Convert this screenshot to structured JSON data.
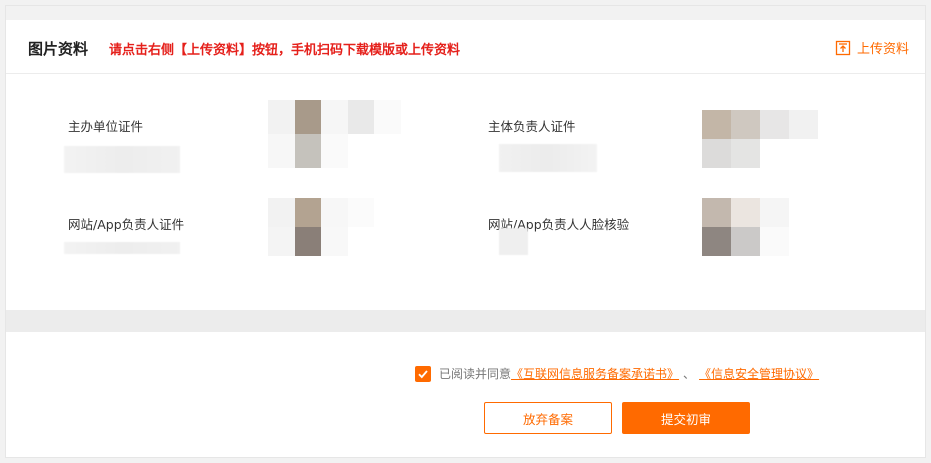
{
  "panel": {
    "title": "图片资料",
    "hint": "请点击右侧【上传资料】按钮，手机扫码下载模版或上传资料",
    "upload_label": "上传资料"
  },
  "documents": [
    {
      "label": "主办单位证件"
    },
    {
      "label": "主体负责人证件"
    },
    {
      "label": "网站/App负责人证件"
    },
    {
      "label": "网站/App负责人人脸核验"
    }
  ],
  "footer": {
    "agree_prefix": "已阅读并同意",
    "agreement1": "《互联网信息服务备案承诺书》",
    "separator": "、",
    "agreement2": "《信息安全管理协议》",
    "cancel_label": "放弃备案",
    "submit_label": "提交初审",
    "checkbox_checked": true
  },
  "colors": {
    "accent": "#ff6a00",
    "hint_red": "#e5201b"
  }
}
